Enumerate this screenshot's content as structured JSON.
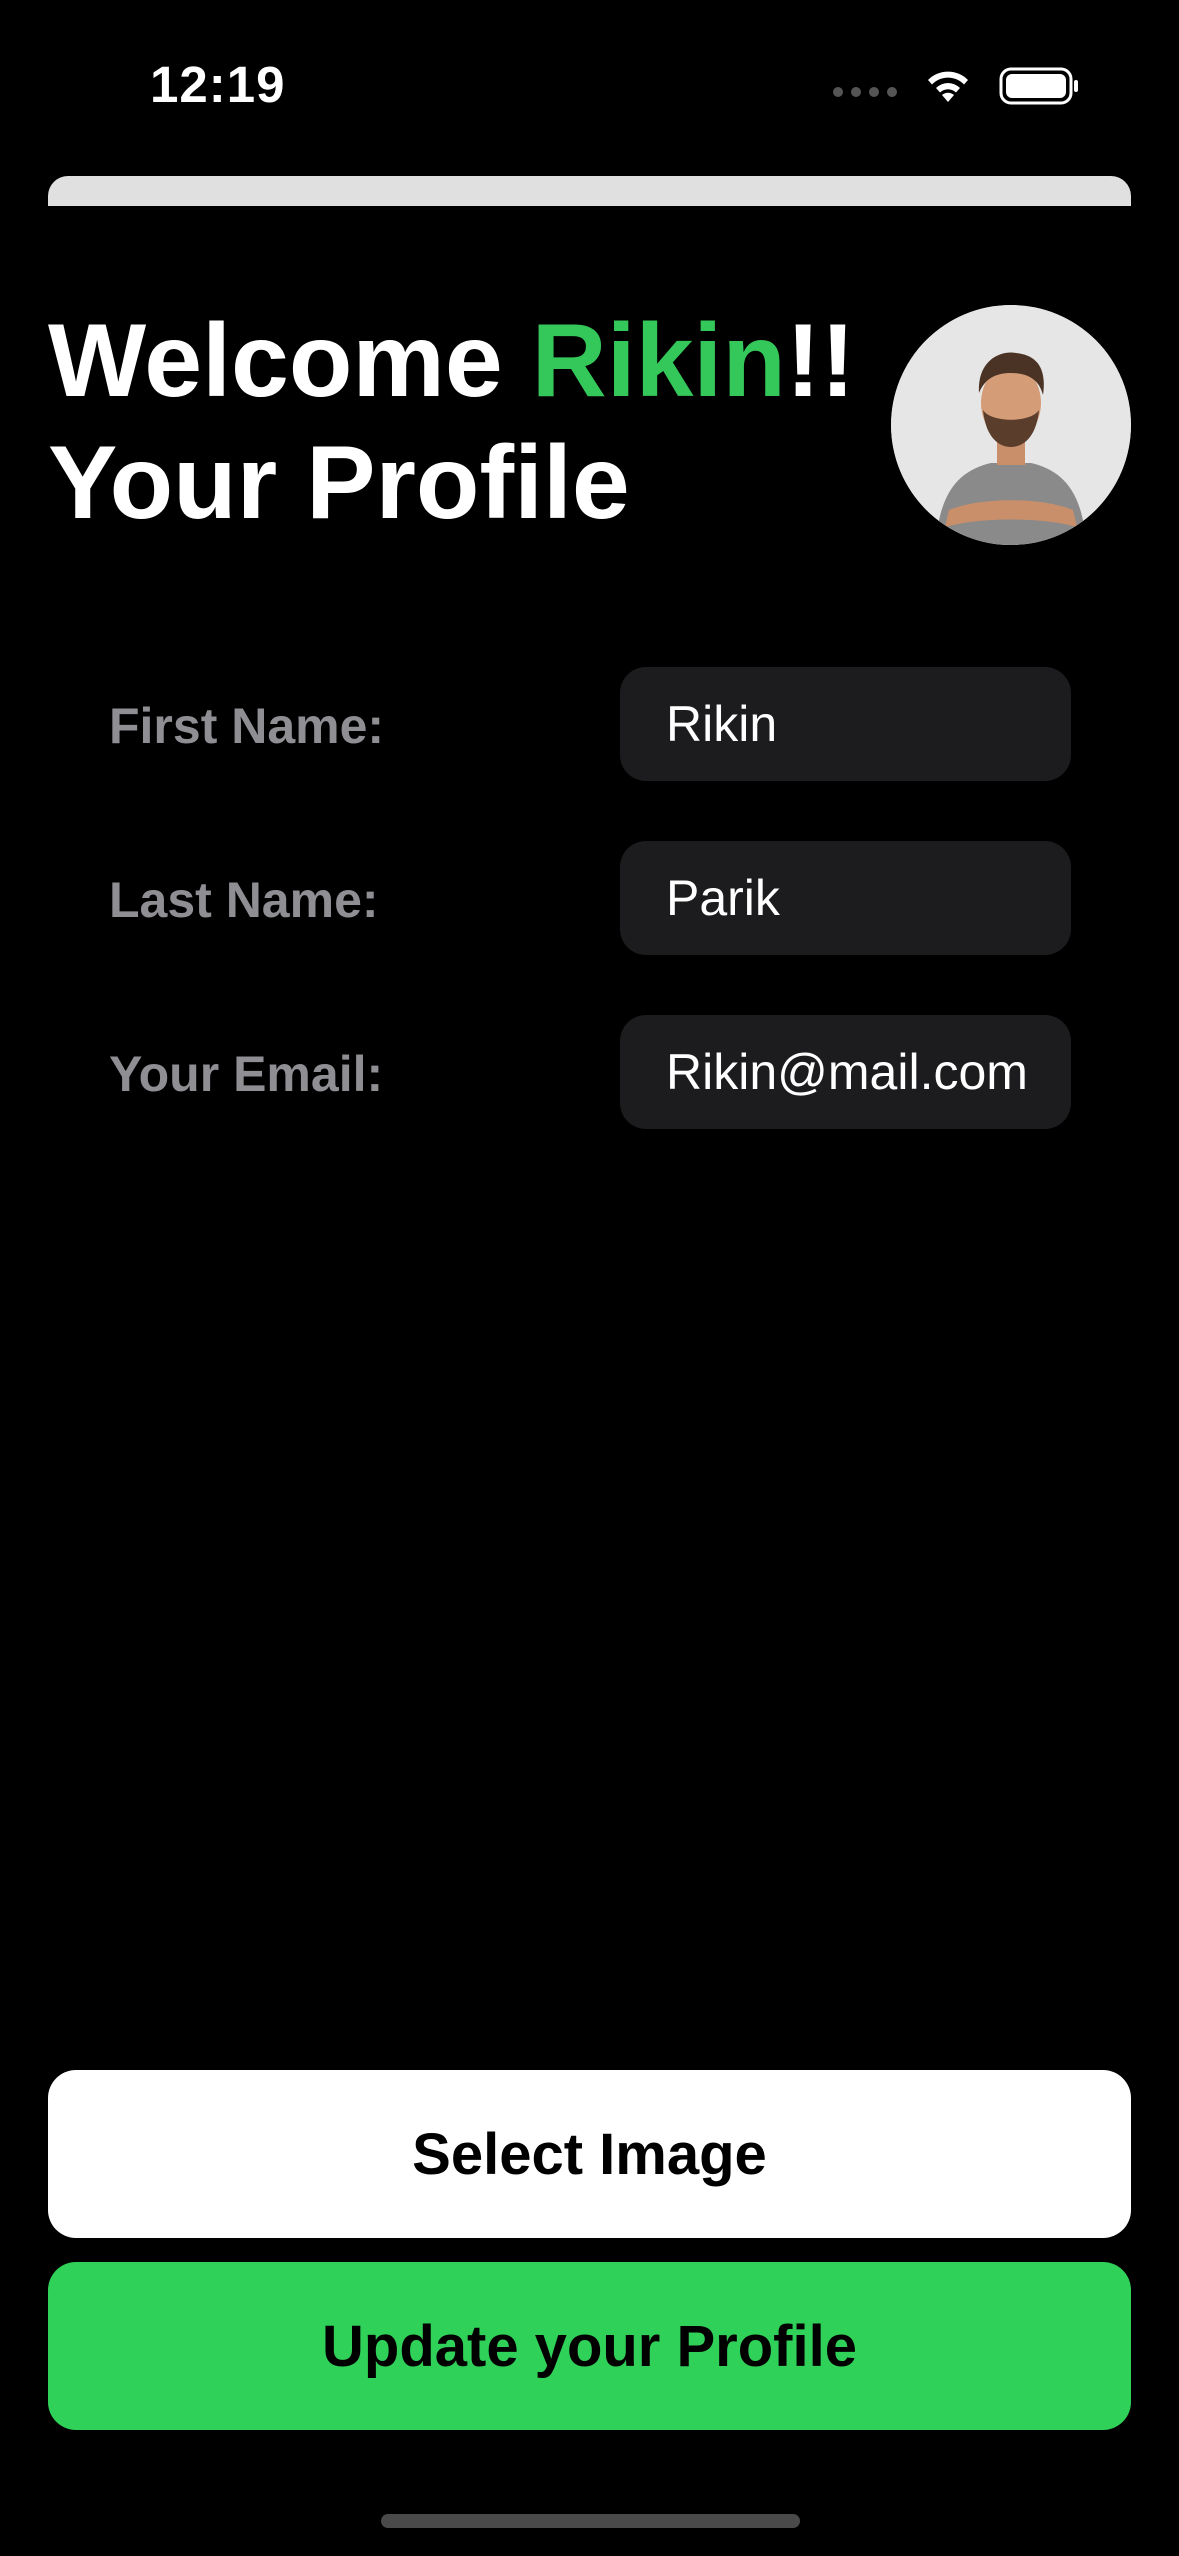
{
  "status_bar": {
    "time": "12:19",
    "icons": [
      "cellular-dots-icon",
      "wifi-icon",
      "battery-icon"
    ]
  },
  "header": {
    "welcome_prefix": "Welcome ",
    "user_name": "Rikin",
    "welcome_suffix": "!!",
    "subtitle": "Your Profile"
  },
  "form": {
    "first_name": {
      "label": "First Name:",
      "value": "Rikin"
    },
    "last_name": {
      "label": "Last Name:",
      "value": "Parik"
    },
    "email": {
      "label": "Your Email:",
      "value": "Rikin@mail.com"
    }
  },
  "actions": {
    "select_image_label": "Select Image",
    "update_profile_label": "Update your Profile"
  },
  "colors": {
    "accent": "#34c759",
    "update_button": "#30d158",
    "background": "#000000",
    "field_bg": "#1c1c1e",
    "label": "#8e8e93"
  }
}
